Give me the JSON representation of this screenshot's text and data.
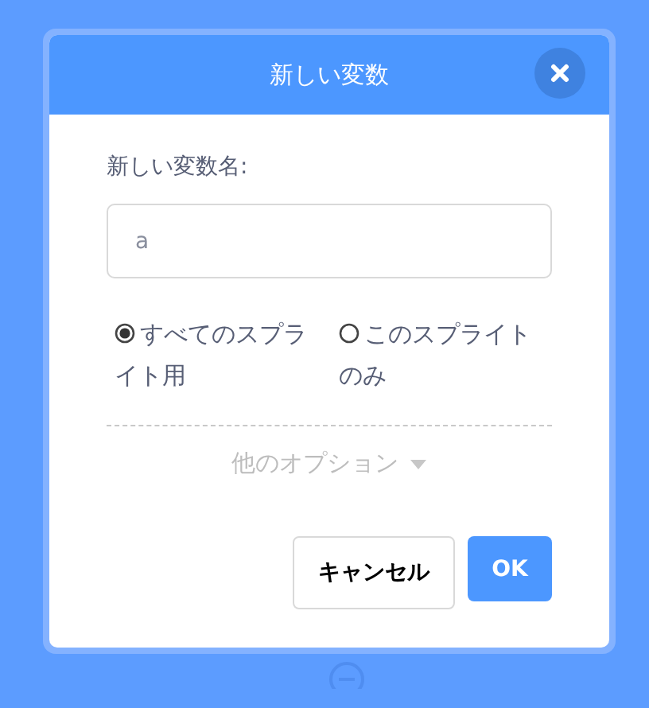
{
  "dialog": {
    "title": "新しい変数",
    "name_label": "新しい変数名:",
    "name_field": {
      "value": "a"
    },
    "scopes": [
      {
        "label": "すべてのスプライト用",
        "selected": true
      },
      {
        "label": "このスプライトのみ",
        "selected": false
      }
    ],
    "more_options": {
      "label": "他のオプション",
      "expanded": false
    },
    "buttons": [
      {
        "label": "キャンセル",
        "kind": "secondary"
      },
      {
        "label": "OK",
        "kind": "primary"
      }
    ]
  }
}
